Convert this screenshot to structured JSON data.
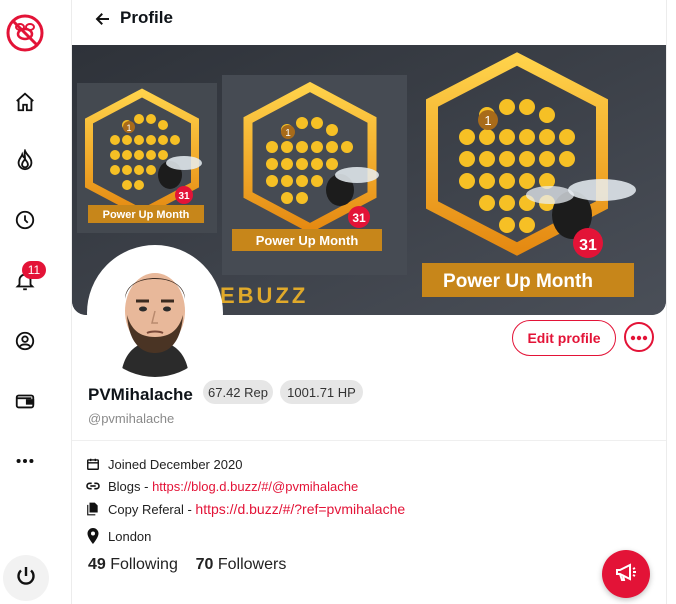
{
  "header": {
    "title": "Profile"
  },
  "sidebar": {
    "notification_count": "11",
    "items": [
      {
        "icon": "home-icon"
      },
      {
        "icon": "trending-icon"
      },
      {
        "icon": "clock-icon"
      },
      {
        "icon": "bell-icon"
      },
      {
        "icon": "user-circle-icon"
      },
      {
        "icon": "wallet-icon"
      },
      {
        "icon": "more-dots-icon"
      }
    ]
  },
  "cover": {
    "panels": [
      {
        "number": "1",
        "badge": "31",
        "caption": "Power Up Month"
      },
      {
        "number": "1",
        "badge": "31",
        "caption": "Power Up Month"
      },
      {
        "number": "1",
        "badge": "31",
        "caption": "Power Up Month"
      }
    ],
    "watermark": "EBUZZ"
  },
  "profile": {
    "edit_label": "Edit profile",
    "display_name": "PVMihalache",
    "reputation": "67.42 Rep",
    "hive_power": "1001.71 HP",
    "handle": "@pvmihalache",
    "joined": "Joined December 2020",
    "blogs_label": "Blogs - ",
    "blogs_url": "https://blog.d.buzz/#/@pvmihalache",
    "referal_label": "Copy Referal - ",
    "referal_url": "https://d.buzz/#/?ref=pvmihalache",
    "location": "London",
    "following_count": "49",
    "following_label": "Following",
    "followers_count": "70",
    "followers_label": "Followers"
  },
  "colors": {
    "accent": "#e31337",
    "cover_bg": "#3b3f47",
    "honey": "#f5b41e"
  }
}
